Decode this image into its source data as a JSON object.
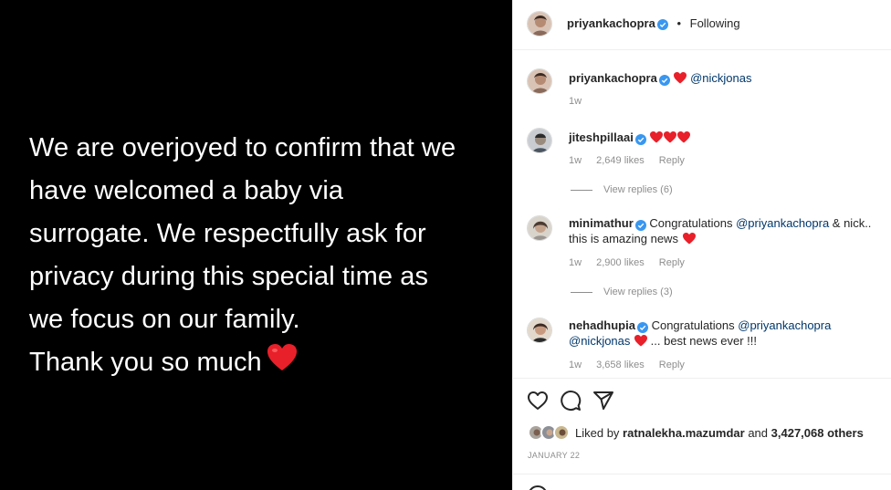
{
  "post": {
    "lines": [
      "We are overjoyed to confirm that we",
      "have welcomed a baby via",
      "surrogate. We respectfully ask for",
      "privacy during this special time as",
      "we focus on our family.",
      "Thank you so much"
    ]
  },
  "header": {
    "username": "priyankachopra",
    "dot": "•",
    "follow_status": "Following"
  },
  "caption": {
    "username": "priyankachopra",
    "mention": "@nickjonas",
    "time": "1w"
  },
  "comments": [
    {
      "username": "jiteshpillaai",
      "time": "1w",
      "likes": "2,649 likes",
      "reply": "Reply",
      "view_replies": "View replies (6)"
    },
    {
      "username": "minimathur",
      "text_a": "Congratulations ",
      "mention_a": "@priyankachopra",
      "text_b": " & nick.. this is amazing news",
      "time": "1w",
      "likes": "2,900 likes",
      "reply": "Reply",
      "view_replies": "View replies (3)"
    },
    {
      "username": "nehadhupia",
      "text_a": "Congratulations ",
      "mention_a": "@priyankachopra",
      "mention_b": "@nickjonas",
      "text_b": " ... best news ever !!!",
      "time": "1w",
      "likes": "3,658 likes",
      "reply": "Reply"
    }
  ],
  "likes": {
    "prefix": "Liked by ",
    "user": "ratnalekha.mazumdar",
    "middle": " and ",
    "count": "3,427,068 others"
  },
  "date": "JANUARY 22",
  "icons": {
    "like": "heart-outline-icon",
    "comment": "comment-bubble-icon",
    "share": "paper-plane-icon",
    "verified": "verified-badge-icon",
    "emoji": "emoji-icon"
  },
  "colors": {
    "verified": "#3897f0",
    "heart": "#ed4956",
    "mention": "#00376b",
    "muted": "#8e8e8e"
  }
}
